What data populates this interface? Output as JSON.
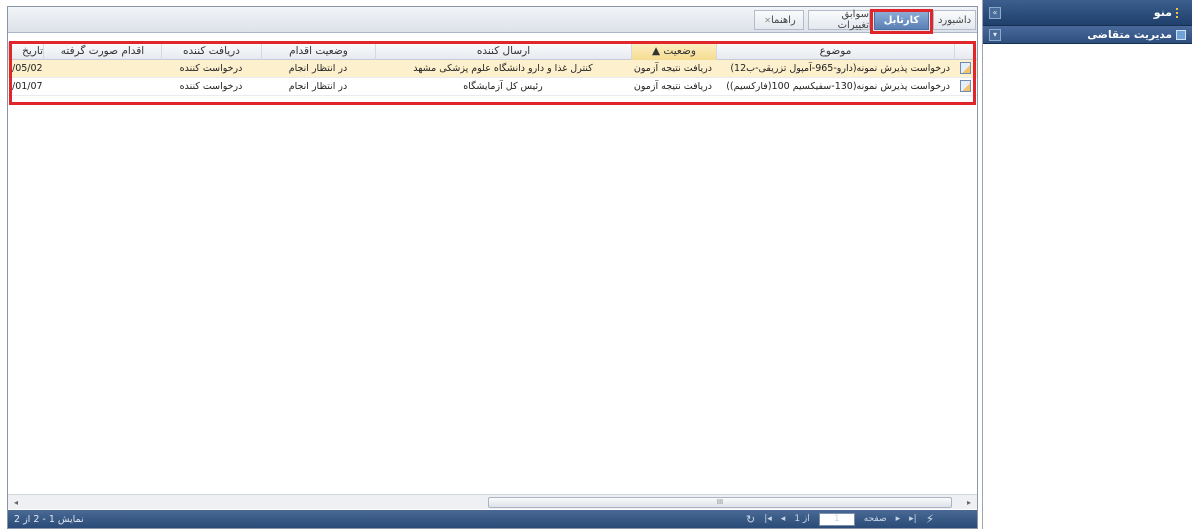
{
  "side": {
    "title": "منو",
    "sub_title": "مدیریت متقاضی",
    "collapse_icon": "double-chevron-icon",
    "expand_icon": "chevron-down-icon"
  },
  "tabs": [
    {
      "label": "داشبورد"
    },
    {
      "label": "کارتابل"
    },
    {
      "label": "سوابق تغییرات"
    },
    {
      "label": "راهنما"
    }
  ],
  "grid": {
    "columns": {
      "subject": "موضوع",
      "status": "وضعیت ▲",
      "sender": "ارسال کننده",
      "action_status": "وضعیت اقدام",
      "receiver": "دریافت کننده",
      "action_done": "اقدام صورت گرفته",
      "date": "تاریخ"
    },
    "rows": [
      {
        "subject": "درخواست پذیرش نمونه(دارو-965-آمپول تزریقی-ب12)",
        "status": "دریافت نتیجه آزمون",
        "sender": "کنترل غذا و دارو دانشگاه علوم پزشکی مشهد",
        "action_status": "در انتظار انجام",
        "receiver": "درخواست کننده",
        "action_done": "",
        "date": "/05/02"
      },
      {
        "subject": "درخواست پذیرش نمونه(130-سفیکسیم 100(فارکسیم))",
        "status": "دریافت نتیجه آزمون",
        "sender": "رئیس کل آزمایشگاه",
        "action_status": "در انتظار انجام",
        "receiver": "درخواست کننده",
        "action_done": "",
        "date": "/01/07"
      }
    ]
  },
  "scrollbar": {
    "grip": "III"
  },
  "pager": {
    "page_label": "صفحه",
    "page_value": "1",
    "of_label": "از 1",
    "info": "نمایش 1 - 2 از 2"
  }
}
